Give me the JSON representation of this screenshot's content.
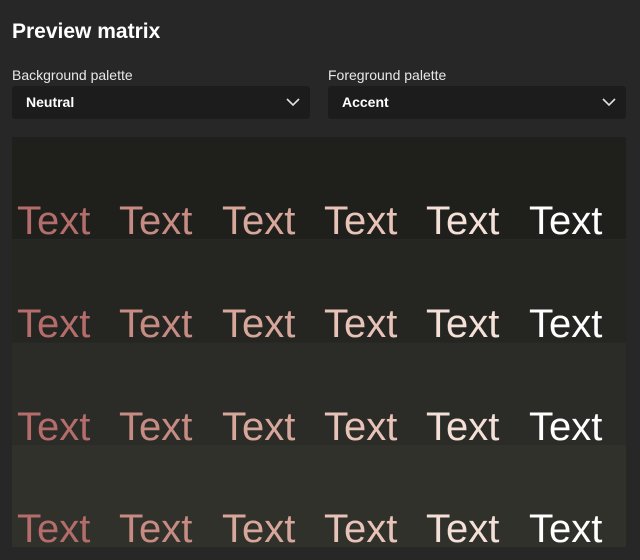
{
  "title": "Preview matrix",
  "background_palette": {
    "label": "Background palette",
    "selected": "Neutral"
  },
  "foreground_palette": {
    "label": "Foreground palette",
    "selected": "Accent"
  },
  "matrix": {
    "row_backgrounds": [
      "#1f1f1c",
      "#252522",
      "#2b2b27",
      "#31312c"
    ],
    "column_foregrounds": [
      "#b46d6a",
      "#c68b82",
      "#d7a79c",
      "#e8c4b8",
      "#f5e0d8",
      "#ffffff"
    ],
    "rows": [
      [
        "Text",
        "Text",
        "Text",
        "Text",
        "Text",
        "Text"
      ],
      [
        "Text",
        "Text",
        "Text",
        "Text",
        "Text",
        "Text"
      ],
      [
        "Text",
        "Text",
        "Text",
        "Text",
        "Text",
        "Text"
      ],
      [
        "Text",
        "Text",
        "Text",
        "Text",
        "Text",
        "Text"
      ]
    ]
  }
}
